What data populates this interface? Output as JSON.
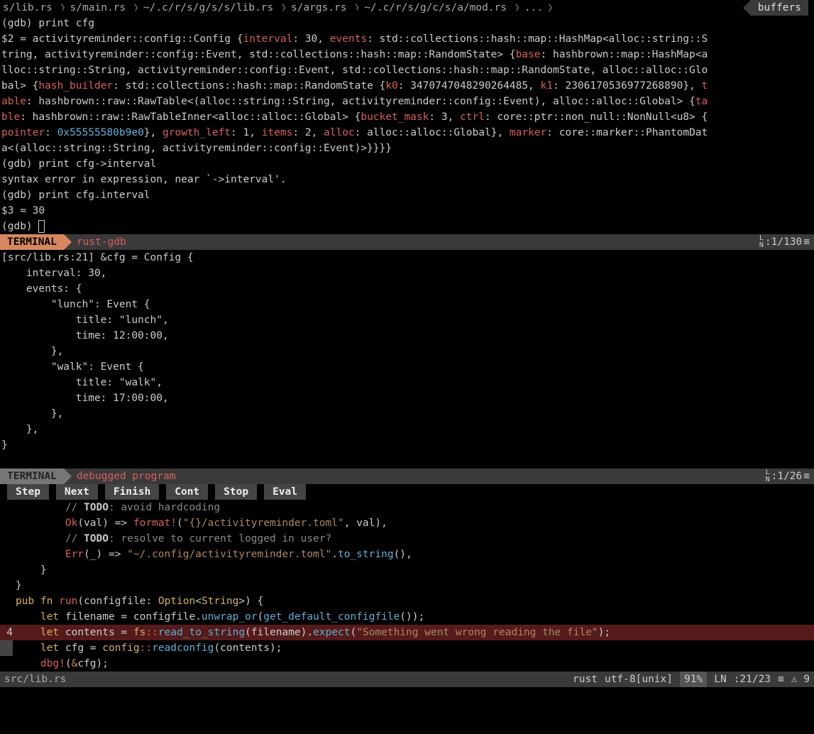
{
  "bufferline": {
    "tabs": [
      "s/lib.rs",
      "s/main.rs",
      "~/.c/r/s/g/s/s/lib.rs",
      "s/args.rs",
      "~/.c/r/s/g/c/s/a/mod.rs"
    ],
    "more": "...",
    "label": "buffers"
  },
  "gdb": {
    "lines": [
      {
        "plain": "(gdb) print cfg"
      },
      {
        "segments": [
          {
            "t": "$2 = activityreminder::config::Config {"
          },
          {
            "t": "interval",
            "c": "identifier"
          },
          {
            "t": ": 30, "
          },
          {
            "t": "events",
            "c": "identifier"
          },
          {
            "t": ": std::collections::hash::map::HashMap<alloc::string::S"
          }
        ]
      },
      {
        "segments": [
          {
            "t": "tring, activityreminder::config::Event, std::collections::hash::map::RandomState> {"
          },
          {
            "t": "base",
            "c": "identifier"
          },
          {
            "t": ": hashbrown::map::HashMap<a"
          }
        ]
      },
      {
        "plain": "lloc::string::String, activityreminder::config::Event, std::collections::hash::map::RandomState, alloc::alloc::Glo"
      },
      {
        "segments": [
          {
            "t": "bal> {"
          },
          {
            "t": "hash_builder",
            "c": "identifier"
          },
          {
            "t": ": std::collections::hash::map::RandomState {"
          },
          {
            "t": "k0",
            "c": "identifier"
          },
          {
            "t": ": 3470747048290264485, "
          },
          {
            "t": "k1",
            "c": "identifier"
          },
          {
            "t": ": 2306170536977268890}, "
          },
          {
            "t": "t",
            "c": "identifier"
          }
        ]
      },
      {
        "segments": [
          {
            "t": "able",
            "c": "identifier"
          },
          {
            "t": ": hashbrown::raw::RawTable<(alloc::string::String, activityreminder::config::Event), alloc::alloc::Global> {"
          },
          {
            "t": "ta",
            "c": "identifier"
          }
        ]
      },
      {
        "segments": [
          {
            "t": "ble",
            "c": "identifier"
          },
          {
            "t": ": hashbrown::raw::RawTableInner<alloc::alloc::Global> {"
          },
          {
            "t": "bucket_mask",
            "c": "identifier"
          },
          {
            "t": ": 3, "
          },
          {
            "t": "ctrl",
            "c": "identifier"
          },
          {
            "t": ": core::ptr::non_null::NonNull<u8> {"
          }
        ]
      },
      {
        "segments": [
          {
            "t": "pointer",
            "c": "identifier"
          },
          {
            "t": ": "
          },
          {
            "t": "0x55555580b9e0",
            "c": "ptr"
          },
          {
            "t": "}, "
          },
          {
            "t": "growth_left",
            "c": "identifier"
          },
          {
            "t": ": 1, "
          },
          {
            "t": "items",
            "c": "identifier"
          },
          {
            "t": ": 2, "
          },
          {
            "t": "alloc",
            "c": "identifier"
          },
          {
            "t": ": alloc::alloc::Global}, "
          },
          {
            "t": "marker",
            "c": "identifier"
          },
          {
            "t": ": core::marker::PhantomDat"
          }
        ]
      },
      {
        "plain": "a<(alloc::string::String, activityreminder::config::Event)>}}}}"
      },
      {
        "plain": "(gdb) print cfg->interval"
      },
      {
        "plain": "syntax error in expression, near `->interval'."
      },
      {
        "plain": "(gdb) print cfg.interval"
      },
      {
        "plain": "$3 = 30"
      },
      {
        "segments": [
          {
            "t": "(gdb) "
          },
          {
            "cursor": true
          }
        ]
      }
    ]
  },
  "status1": {
    "mode": "TERMINAL",
    "title": "rust-gdb",
    "pos": ":1/130",
    "ln": "L\nN"
  },
  "dbgout": {
    "lines": [
      "[src/lib.rs:21] &cfg = Config {",
      "    interval: 30,",
      "    events: {",
      "        \"lunch\": Event {",
      "            title: \"lunch\",",
      "            time: 12:00:00,",
      "        },",
      "        \"walk\": Event {",
      "            title: \"walk\",",
      "            time: 17:00:00,",
      "        },",
      "    },",
      "}"
    ]
  },
  "status2": {
    "mode": "TERMINAL",
    "title": "debugged program",
    "pos": ":1/26"
  },
  "debugbar": {
    "buttons": [
      "Step",
      "Next",
      "Finish",
      "Cont",
      "Stop",
      "Eval"
    ]
  },
  "code": {
    "lines": [
      {
        "html": "        <span class='comment'>// <span class='kw-todo'>TODO</span>: avoid hardcoding</span>"
      },
      {
        "html": "        <span class='ok'>Ok</span>(val) =&gt; <span class='macro'>format!</span>(<span class='string'>\"{}/activityreminder.toml\"</span>, val),"
      },
      {
        "html": "        <span class='comment'>// <span class='kw-todo'>TODO</span>: resolve to current logged in user?</span>"
      },
      {
        "html": "        <span class='err'>Err</span>(_) =&gt; <span class='string'>\"~/.config/activityreminder.toml\"</span>.<span class='method'>to_string</span>(),"
      },
      {
        "html": "    }"
      },
      {
        "html": "}"
      },
      {
        "html": ""
      },
      {
        "html": "<span class='pub'>pub</span> <span class='fn'>fn</span> <span class='fn-name'>run</span>(configfile: <span class='type'>Option</span>&lt;<span class='type'>String</span>&gt;) {"
      },
      {
        "html": "    <span class='let'>let</span> filename = configfile.<span class='method'>unwrap_or</span>(<span class='method'>get_default_configfile</span>());"
      },
      {
        "html": ""
      },
      {
        "bp": "4",
        "html": "    <span class='let'>let</span> contents = <span class='ns'>fs</span><span class='punct-ns'>::</span><span class='method'>read_to_string</span>(filename).<span class='method'>expect</span>(<span class='string'>\"Something went wrong reading the file\"</span>);"
      },
      {
        "cur": true,
        "html": "    <span class='let'>let</span> cfg = <span class='ns'>config</span><span class='punct-ns'>::</span><span class='method'>readconfig</span>(contents);"
      },
      {
        "html": "    <span class='macro'>dbg!</span>(<span class='kw'>&amp;</span>cfg);"
      }
    ]
  },
  "bottom": {
    "file": "src/lib.rs",
    "lang": "rust",
    "enc": "utf-8[unix]",
    "pct": "91%",
    "pos": ":21/23",
    "warn": "⚠ 9"
  }
}
